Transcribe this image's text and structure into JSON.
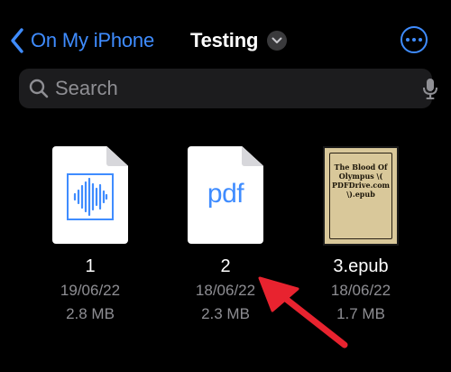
{
  "nav": {
    "back_label": "On My iPhone",
    "title": "Testing"
  },
  "search": {
    "placeholder": "Search"
  },
  "files": [
    {
      "name": "1",
      "date": "19/06/22",
      "size": "2.8 MB",
      "kind": "audio"
    },
    {
      "name": "2",
      "date": "18/06/22",
      "size": "2.3 MB",
      "kind": "pdf",
      "badge": "pdf"
    },
    {
      "name": "3.epub",
      "date": "18/06/22",
      "size": "1.7 MB",
      "kind": "epub",
      "cover_text": [
        "The Blood Of",
        "Olympus \\(",
        "PDFDrive.com",
        "\\).epub"
      ]
    }
  ],
  "colors": {
    "background": "#000000",
    "accent": "#3f8cff",
    "secondary_text": "#8e8e93",
    "search_field": "#1c1c1e",
    "annotation_arrow": "#e8232f"
  },
  "icons": {
    "back": "chevron-left-icon",
    "title_menu": "chevron-down-icon",
    "more": "ellipsis-circle-icon",
    "search": "magnifying-glass-icon",
    "mic": "microphone-icon",
    "annotation": "red-arrow-icon"
  }
}
